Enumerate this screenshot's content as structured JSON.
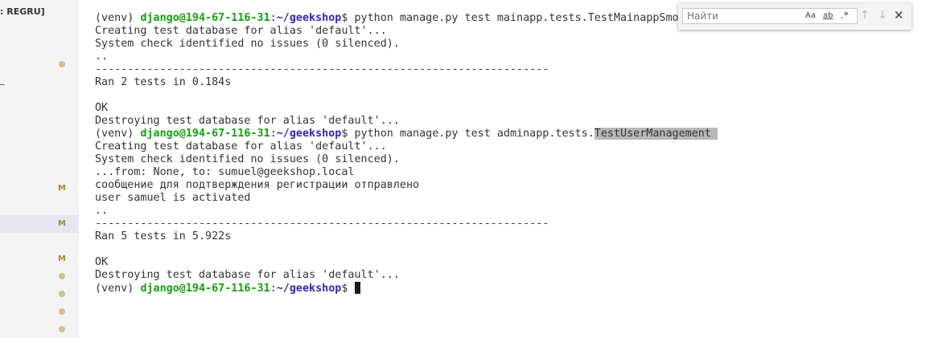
{
  "sidebar": {
    "header": ": REGRU]",
    "badge_label": "M"
  },
  "terminal": {
    "lines": [
      [
        {
          "t": "(venv) ",
          "c": ""
        },
        {
          "t": "django@194-67-116-31",
          "c": "u"
        },
        {
          "t": ":",
          "c": ""
        },
        {
          "t": "~/geekshop",
          "c": "p"
        },
        {
          "t": "$ python manage.py test mainapp.tests.TestMainappSmoke",
          "c": ""
        }
      ],
      [
        {
          "t": "Creating test database for alias 'default'...",
          "c": ""
        }
      ],
      [
        {
          "t": "System check identified no issues (0 silenced).",
          "c": ""
        }
      ],
      [
        {
          "t": "..",
          "c": ""
        }
      ],
      [
        {
          "t": "----------------------------------------------------------------------",
          "c": ""
        }
      ],
      [
        {
          "t": "Ran 2 tests in 0.184s",
          "c": ""
        }
      ],
      [
        {
          "t": "",
          "c": ""
        }
      ],
      [
        {
          "t": "OK",
          "c": ""
        }
      ],
      [
        {
          "t": "Destroying test database for alias 'default'...",
          "c": ""
        }
      ],
      [
        {
          "t": "(venv) ",
          "c": ""
        },
        {
          "t": "django@194-67-116-31",
          "c": "u"
        },
        {
          "t": ":",
          "c": ""
        },
        {
          "t": "~/geekshop",
          "c": "p"
        },
        {
          "t": "$ python manage.py test adminapp.tests.",
          "c": ""
        },
        {
          "t": "TestUserManagement ",
          "c": "hl"
        }
      ],
      [
        {
          "t": "Creating test database for alias 'default'...",
          "c": ""
        }
      ],
      [
        {
          "t": "System check identified no issues (0 silenced).",
          "c": ""
        }
      ],
      [
        {
          "t": "...from: None, to: sumuel@geekshop.local",
          "c": ""
        }
      ],
      [
        {
          "t": "сообщение для подтверждения регистрации отправлено",
          "c": ""
        }
      ],
      [
        {
          "t": "user samuel is activated",
          "c": ""
        }
      ],
      [
        {
          "t": "..",
          "c": ""
        }
      ],
      [
        {
          "t": "----------------------------------------------------------------------",
          "c": ""
        }
      ],
      [
        {
          "t": "Ran 5 tests in 5.922s",
          "c": ""
        }
      ],
      [
        {
          "t": "",
          "c": ""
        }
      ],
      [
        {
          "t": "OK",
          "c": ""
        }
      ],
      [
        {
          "t": "Destroying test database for alias 'default'...",
          "c": ""
        }
      ],
      [
        {
          "t": "(venv) ",
          "c": ""
        },
        {
          "t": "django@194-67-116-31",
          "c": "u"
        },
        {
          "t": ":",
          "c": ""
        },
        {
          "t": "~/geekshop",
          "c": "p"
        },
        {
          "t": "$ ",
          "c": ""
        },
        {
          "t": "",
          "c": "cursor"
        }
      ]
    ],
    "colors": {
      "user": "#13a10e",
      "path": "#3524b4",
      "highlight": "#b8b8b8",
      "text": "#333333"
    }
  },
  "find": {
    "placeholder": "Найти",
    "match_case_label": "Aa",
    "whole_word_label": "ab",
    "regex_label": ".*",
    "prev_icon": "arrow-up-icon",
    "next_icon": "arrow-down-icon",
    "close_icon": "close-icon"
  }
}
